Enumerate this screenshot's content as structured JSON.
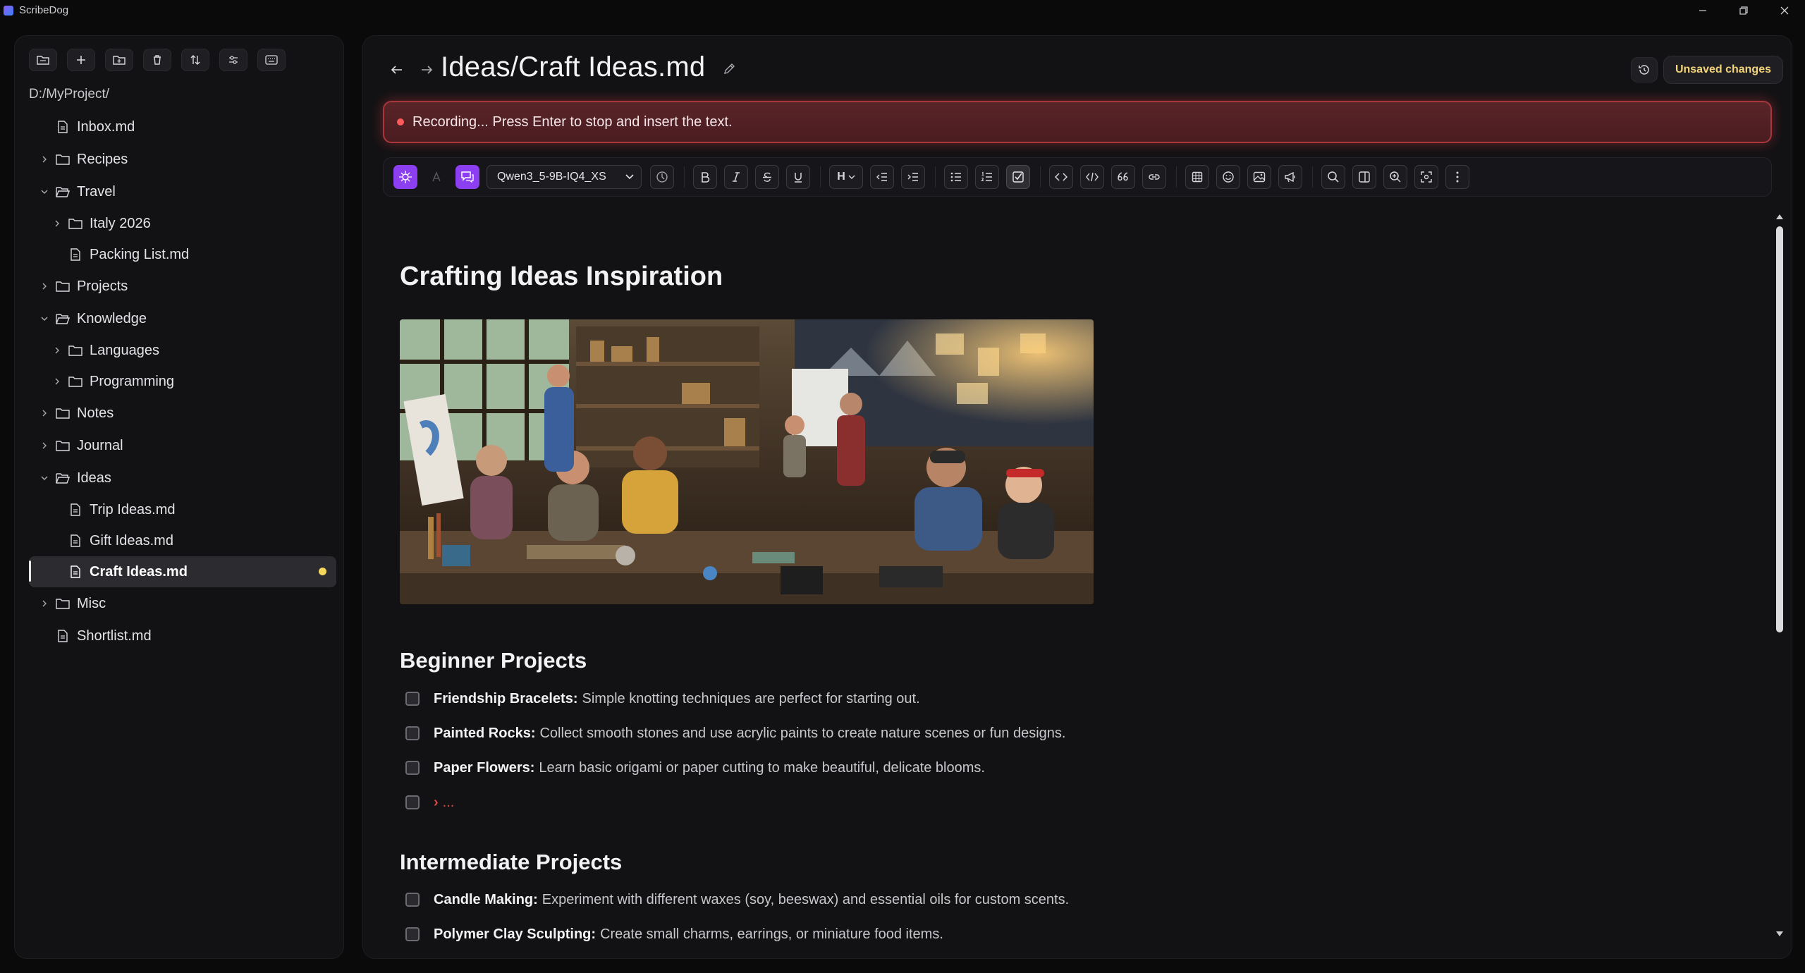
{
  "app": {
    "name": "ScribeDog"
  },
  "window": {
    "minimize": "—",
    "restore": "❐",
    "close": "✕"
  },
  "sidebar": {
    "path": "D:/MyProject/",
    "tree": [
      {
        "label": "Inbox.md",
        "type": "file",
        "depth": 0
      },
      {
        "label": "Recipes",
        "type": "folder",
        "depth": 0,
        "expanded": false
      },
      {
        "label": "Travel",
        "type": "folder",
        "depth": 0,
        "expanded": true
      },
      {
        "label": "Italy 2026",
        "type": "folder",
        "depth": 1,
        "expanded": false
      },
      {
        "label": "Packing List.md",
        "type": "file",
        "depth": 1
      },
      {
        "label": "Projects",
        "type": "folder",
        "depth": 0,
        "expanded": false
      },
      {
        "label": "Knowledge",
        "type": "folder",
        "depth": 0,
        "expanded": true
      },
      {
        "label": "Languages",
        "type": "folder",
        "depth": 1,
        "expanded": false
      },
      {
        "label": "Programming",
        "type": "folder",
        "depth": 1,
        "expanded": false
      },
      {
        "label": "Notes",
        "type": "folder",
        "depth": 0,
        "expanded": false
      },
      {
        "label": "Journal",
        "type": "folder",
        "depth": 0,
        "expanded": false
      },
      {
        "label": "Ideas",
        "type": "folder",
        "depth": 0,
        "expanded": true
      },
      {
        "label": "Trip Ideas.md",
        "type": "file",
        "depth": 1
      },
      {
        "label": "Gift Ideas.md",
        "type": "file",
        "depth": 1
      },
      {
        "label": "Craft Ideas.md",
        "type": "file",
        "depth": 1,
        "active": true,
        "unsaved": true
      },
      {
        "label": "Misc",
        "type": "folder",
        "depth": 0,
        "expanded": false
      },
      {
        "label": "Shortlist.md",
        "type": "file",
        "depth": 0
      }
    ]
  },
  "header": {
    "title": "Ideas/Craft Ideas.md",
    "unsaved_label": "Unsaved changes"
  },
  "recording": {
    "text": "Recording... Press Enter to stop and insert the text."
  },
  "toolbar": {
    "model": "Qwen3_5-9B-IQ4_XS",
    "heading_label": "H"
  },
  "document": {
    "title": "Crafting Ideas Inspiration",
    "sections": [
      {
        "heading": "Beginner Projects",
        "tasks": [
          {
            "bold": "Friendship Bracelets:",
            "text": "Simple knotting techniques are perfect for starting out."
          },
          {
            "bold": "Painted Rocks:",
            "text": "Collect smooth stones and use acrylic paints to create nature scenes or fun designs."
          },
          {
            "bold": "Paper Flowers:",
            "text": "Learn basic origami or paper cutting to make beautiful, delicate blooms."
          },
          {
            "bold": "",
            "text": "...",
            "recording": true
          }
        ]
      },
      {
        "heading": "Intermediate Projects",
        "tasks": [
          {
            "bold": "Candle Making:",
            "text": "Experiment with different waxes (soy, beeswax) and essential oils for custom scents."
          },
          {
            "bold": "Polymer Clay Sculpting:",
            "text": "Create small charms, earrings, or miniature food items."
          }
        ]
      }
    ]
  },
  "colors": {
    "accent": "#8b3ff0",
    "recording": "#a8363d",
    "unsaved": "#f5d75c"
  }
}
